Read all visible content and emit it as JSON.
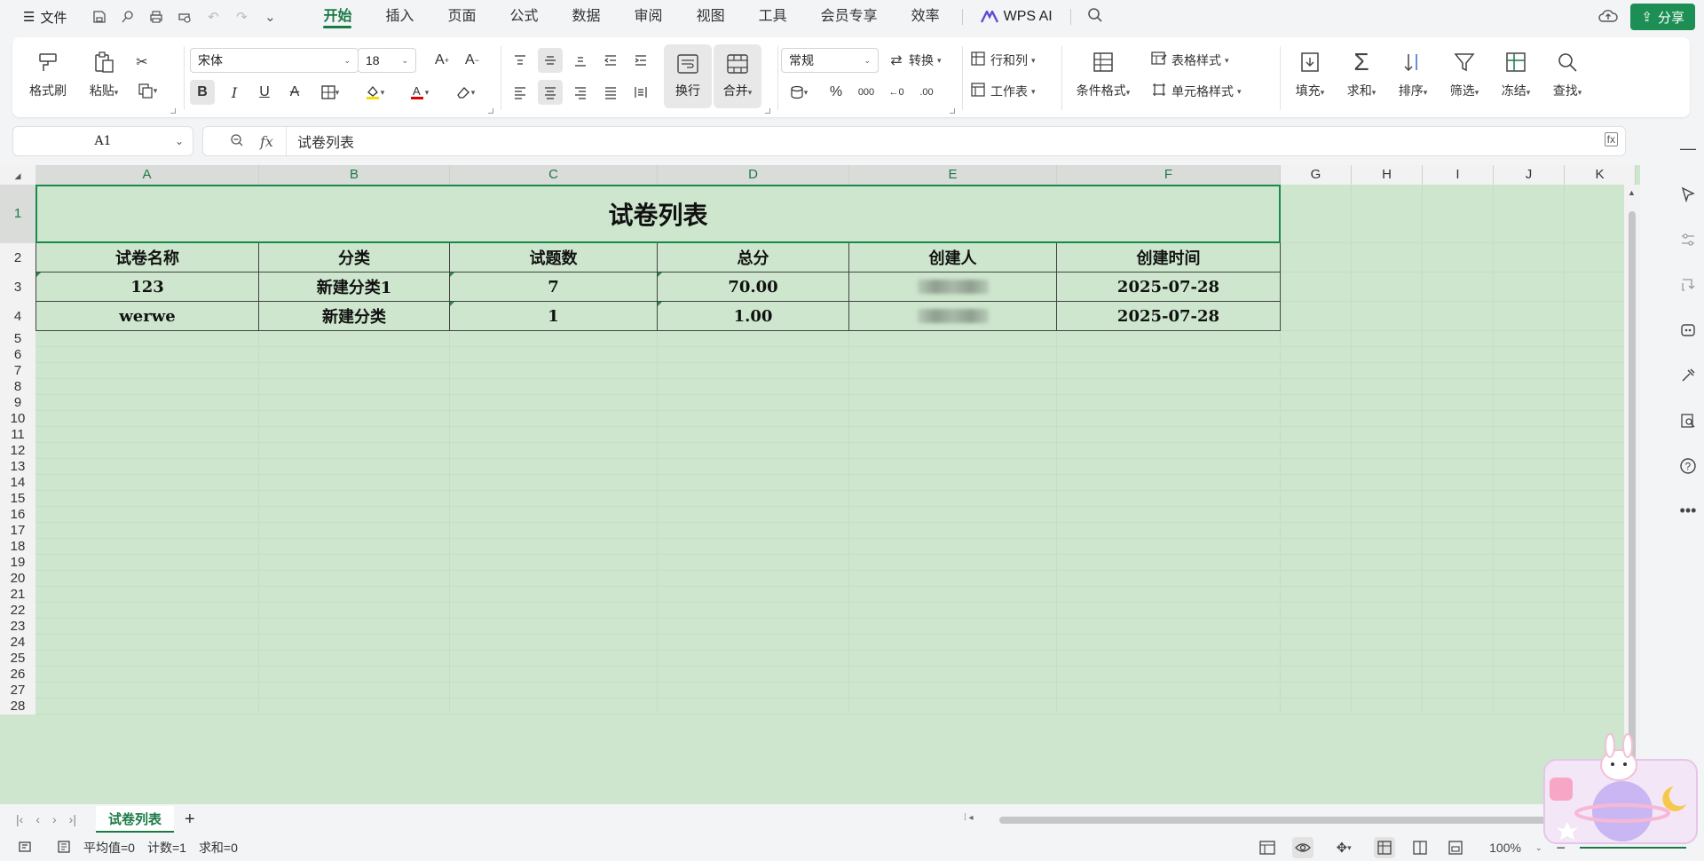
{
  "menubar": {
    "file_label": "文件",
    "tabs": [
      "开始",
      "插入",
      "页面",
      "公式",
      "数据",
      "审阅",
      "视图",
      "工具",
      "会员专享",
      "效率"
    ],
    "active_tab": "开始",
    "wps_ai_label": "WPS AI",
    "share_label": "分享"
  },
  "ribbon": {
    "format_painter": "格式刷",
    "paste": "粘贴",
    "font_name": "宋体",
    "font_size": "18",
    "wrap": "换行",
    "merge": "合并",
    "number_format": "常规",
    "convert": "转换",
    "row_col": "行和列",
    "worksheet": "工作表",
    "cond_format": "条件格式",
    "table_style": "表格样式",
    "cell_style": "单元格样式",
    "fill": "填充",
    "sum": "求和",
    "sort": "排序",
    "filter": "筛选",
    "freeze": "冻结",
    "find": "查找"
  },
  "formula": {
    "cell_ref": "A1",
    "content": "试卷列表"
  },
  "columns": [
    "A",
    "B",
    "C",
    "D",
    "E",
    "F",
    "G",
    "H",
    "I",
    "J",
    "K"
  ],
  "rows": [
    "1",
    "2",
    "3",
    "4",
    "5",
    "6",
    "7",
    "8",
    "9",
    "10",
    "11",
    "12",
    "13",
    "14",
    "15",
    "16",
    "17",
    "18",
    "19",
    "20",
    "21",
    "22",
    "23",
    "24",
    "25",
    "26",
    "27",
    "28"
  ],
  "sheet": {
    "title": "试卷列表",
    "headers": [
      "试卷名称",
      "分类",
      "试题数",
      "总分",
      "创建人",
      "创建时间"
    ],
    "data": [
      [
        "123",
        "新建分类1",
        "7",
        "70.00",
        "",
        "2025-07-28"
      ],
      [
        "werwe",
        "新建分类",
        "1",
        "1.00",
        "",
        "2025-07-28"
      ]
    ]
  },
  "sheet_tabs": [
    "试卷列表"
  ],
  "status": {
    "average": "平均值=0",
    "count": "计数=1",
    "sum": "求和=0",
    "zoom": "100%"
  },
  "colors": {
    "accent": "#1a7a46",
    "grid_bg": "#cde6cd"
  }
}
